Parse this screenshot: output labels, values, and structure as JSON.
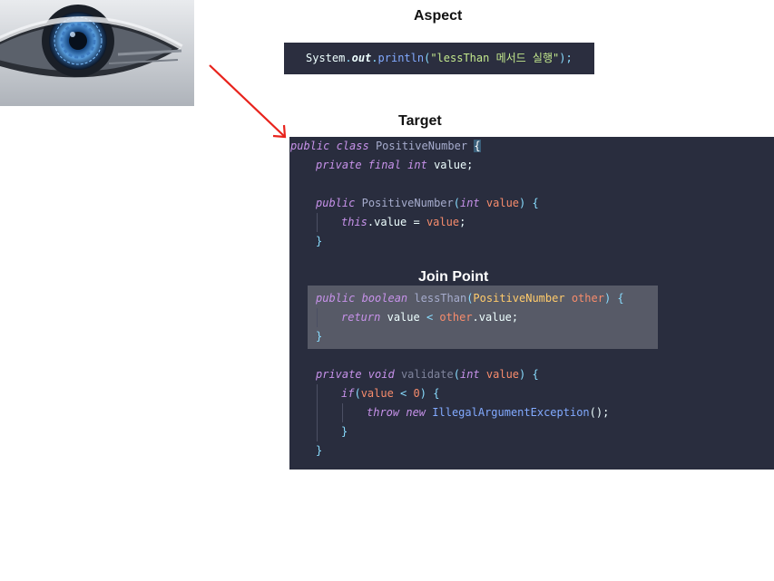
{
  "headings": {
    "aspect": "Aspect",
    "target": "Target",
    "join_point": "Join Point"
  },
  "aspect_code": {
    "system": "System",
    "dot1": ".",
    "out": "out",
    "dot2": ".",
    "println": "println",
    "paren_open": "(",
    "string": "\"lessThan 메서드 실행\"",
    "paren_close": ");"
  },
  "target_code": {
    "l1": {
      "kw": "public class",
      "name": "PositiveNumber",
      "brace": "{"
    },
    "l2": {
      "kw": "private final int",
      "rest": "value;"
    },
    "l4": {
      "kw": "public",
      "name": "PositiveNumber",
      "open": "(",
      "type": "int",
      "param": "value",
      "close": ") {"
    },
    "l5": {
      "kw": "this",
      "mid": ".value = ",
      "param": "value",
      "end": ";"
    },
    "l6": {
      "text": "}"
    },
    "l8": {
      "kw": "public boolean",
      "name": "lessThan",
      "open": "(",
      "type": "PositiveNumber",
      "param": "other",
      "close": ") {"
    },
    "l9": {
      "kw": "return",
      "mid": "value",
      "op": "<",
      "param": "other",
      "end": ".value;"
    },
    "l10": {
      "text": "}"
    },
    "l12": {
      "kw": "private void",
      "name": "validate",
      "open": "(",
      "type": "int",
      "param": "value",
      "close": ") {"
    },
    "l13": {
      "kw": "if",
      "open": "(",
      "var": "value",
      "op": "<",
      "num": "0",
      "close": ") {"
    },
    "l14": {
      "kw": "throw new",
      "cls": "IllegalArgumentException",
      "end": "();"
    },
    "l15": {
      "text": "}"
    },
    "l16": {
      "text": "}"
    }
  },
  "colors": {
    "code_bg": "#292d3e",
    "highlight_bg": "#575a67",
    "arrow": "#e8231c"
  },
  "icons": {
    "eye_image": "robot-eye-image",
    "arrow": "arrow-down-right-icon"
  }
}
